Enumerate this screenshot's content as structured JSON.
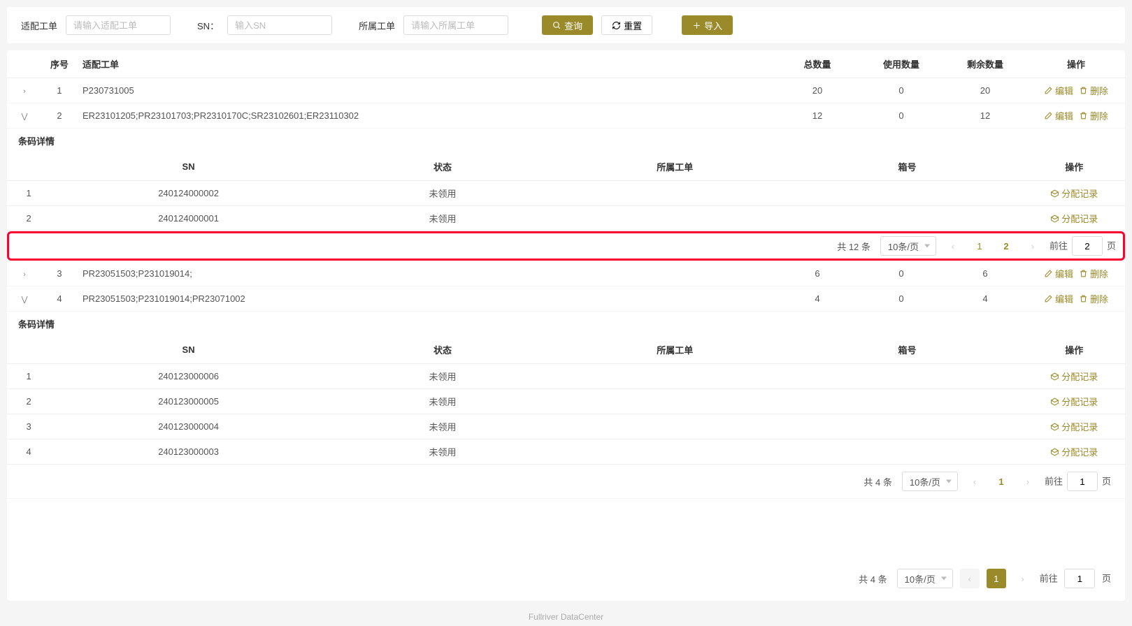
{
  "filters": {
    "order_label": "适配工单",
    "order_ph": "请输入适配工单",
    "sn_label": "SN：",
    "sn_ph": "输入SN",
    "owner_label": "所属工单",
    "owner_ph": "请输入所属工单",
    "query": "查询",
    "reset": "重置",
    "import": "导入"
  },
  "main_headers": {
    "idx": "序号",
    "order": "适配工单",
    "total": "总数量",
    "used": "使用数量",
    "remain": "剩余数量",
    "op": "操作"
  },
  "actions": {
    "edit": "编辑",
    "delete": "删除",
    "alloc": "分配记录"
  },
  "rows": [
    {
      "expanded": false,
      "idx": "1",
      "order": "P230731005",
      "total": "20",
      "used": "0",
      "remain": "20"
    },
    {
      "expanded": true,
      "idx": "2",
      "order": "ER23101205;PR23101703;PR2310170C;SR23102601;ER23110302",
      "total": "12",
      "used": "0",
      "remain": "12"
    },
    {
      "expanded": false,
      "idx": "3",
      "order": "PR23051503;P231019014;",
      "total": "6",
      "used": "0",
      "remain": "6"
    },
    {
      "expanded": true,
      "idx": "4",
      "order": "PR23051503;P231019014;PR23071002",
      "total": "4",
      "used": "0",
      "remain": "4"
    }
  ],
  "detail_title": "条码详情",
  "detail_headers": {
    "sn": "SN",
    "status": "状态",
    "owner": "所属工单",
    "box": "箱号",
    "op": "操作"
  },
  "detail1": [
    {
      "idx": "1",
      "sn": "240124000002",
      "status": "未领用",
      "owner": "",
      "box": ""
    },
    {
      "idx": "2",
      "sn": "240124000001",
      "status": "未领用",
      "owner": "",
      "box": ""
    }
  ],
  "detail2": [
    {
      "idx": "1",
      "sn": "240123000006",
      "status": "未领用",
      "owner": "",
      "box": ""
    },
    {
      "idx": "2",
      "sn": "240123000005",
      "status": "未领用",
      "owner": "",
      "box": ""
    },
    {
      "idx": "3",
      "sn": "240123000004",
      "status": "未领用",
      "owner": "",
      "box": ""
    },
    {
      "idx": "4",
      "sn": "240123000003",
      "status": "未领用",
      "owner": "",
      "box": ""
    }
  ],
  "pag1": {
    "total": "共 12 条",
    "size": "10条/页",
    "pages": [
      "1",
      "2"
    ],
    "current": "2",
    "goto_label": "前往",
    "goto_val": "2",
    "suffix": "页"
  },
  "pag2": {
    "total": "共 4 条",
    "size": "10条/页",
    "pages": [
      "1"
    ],
    "current": "1",
    "goto_label": "前往",
    "goto_val": "1",
    "suffix": "页"
  },
  "pag3": {
    "total": "共 4 条",
    "size": "10条/页",
    "pages": [
      "1"
    ],
    "current": "1",
    "goto_label": "前往",
    "goto_val": "1",
    "suffix": "页",
    "active_style": true
  },
  "footer": "Fullriver DataCenter"
}
